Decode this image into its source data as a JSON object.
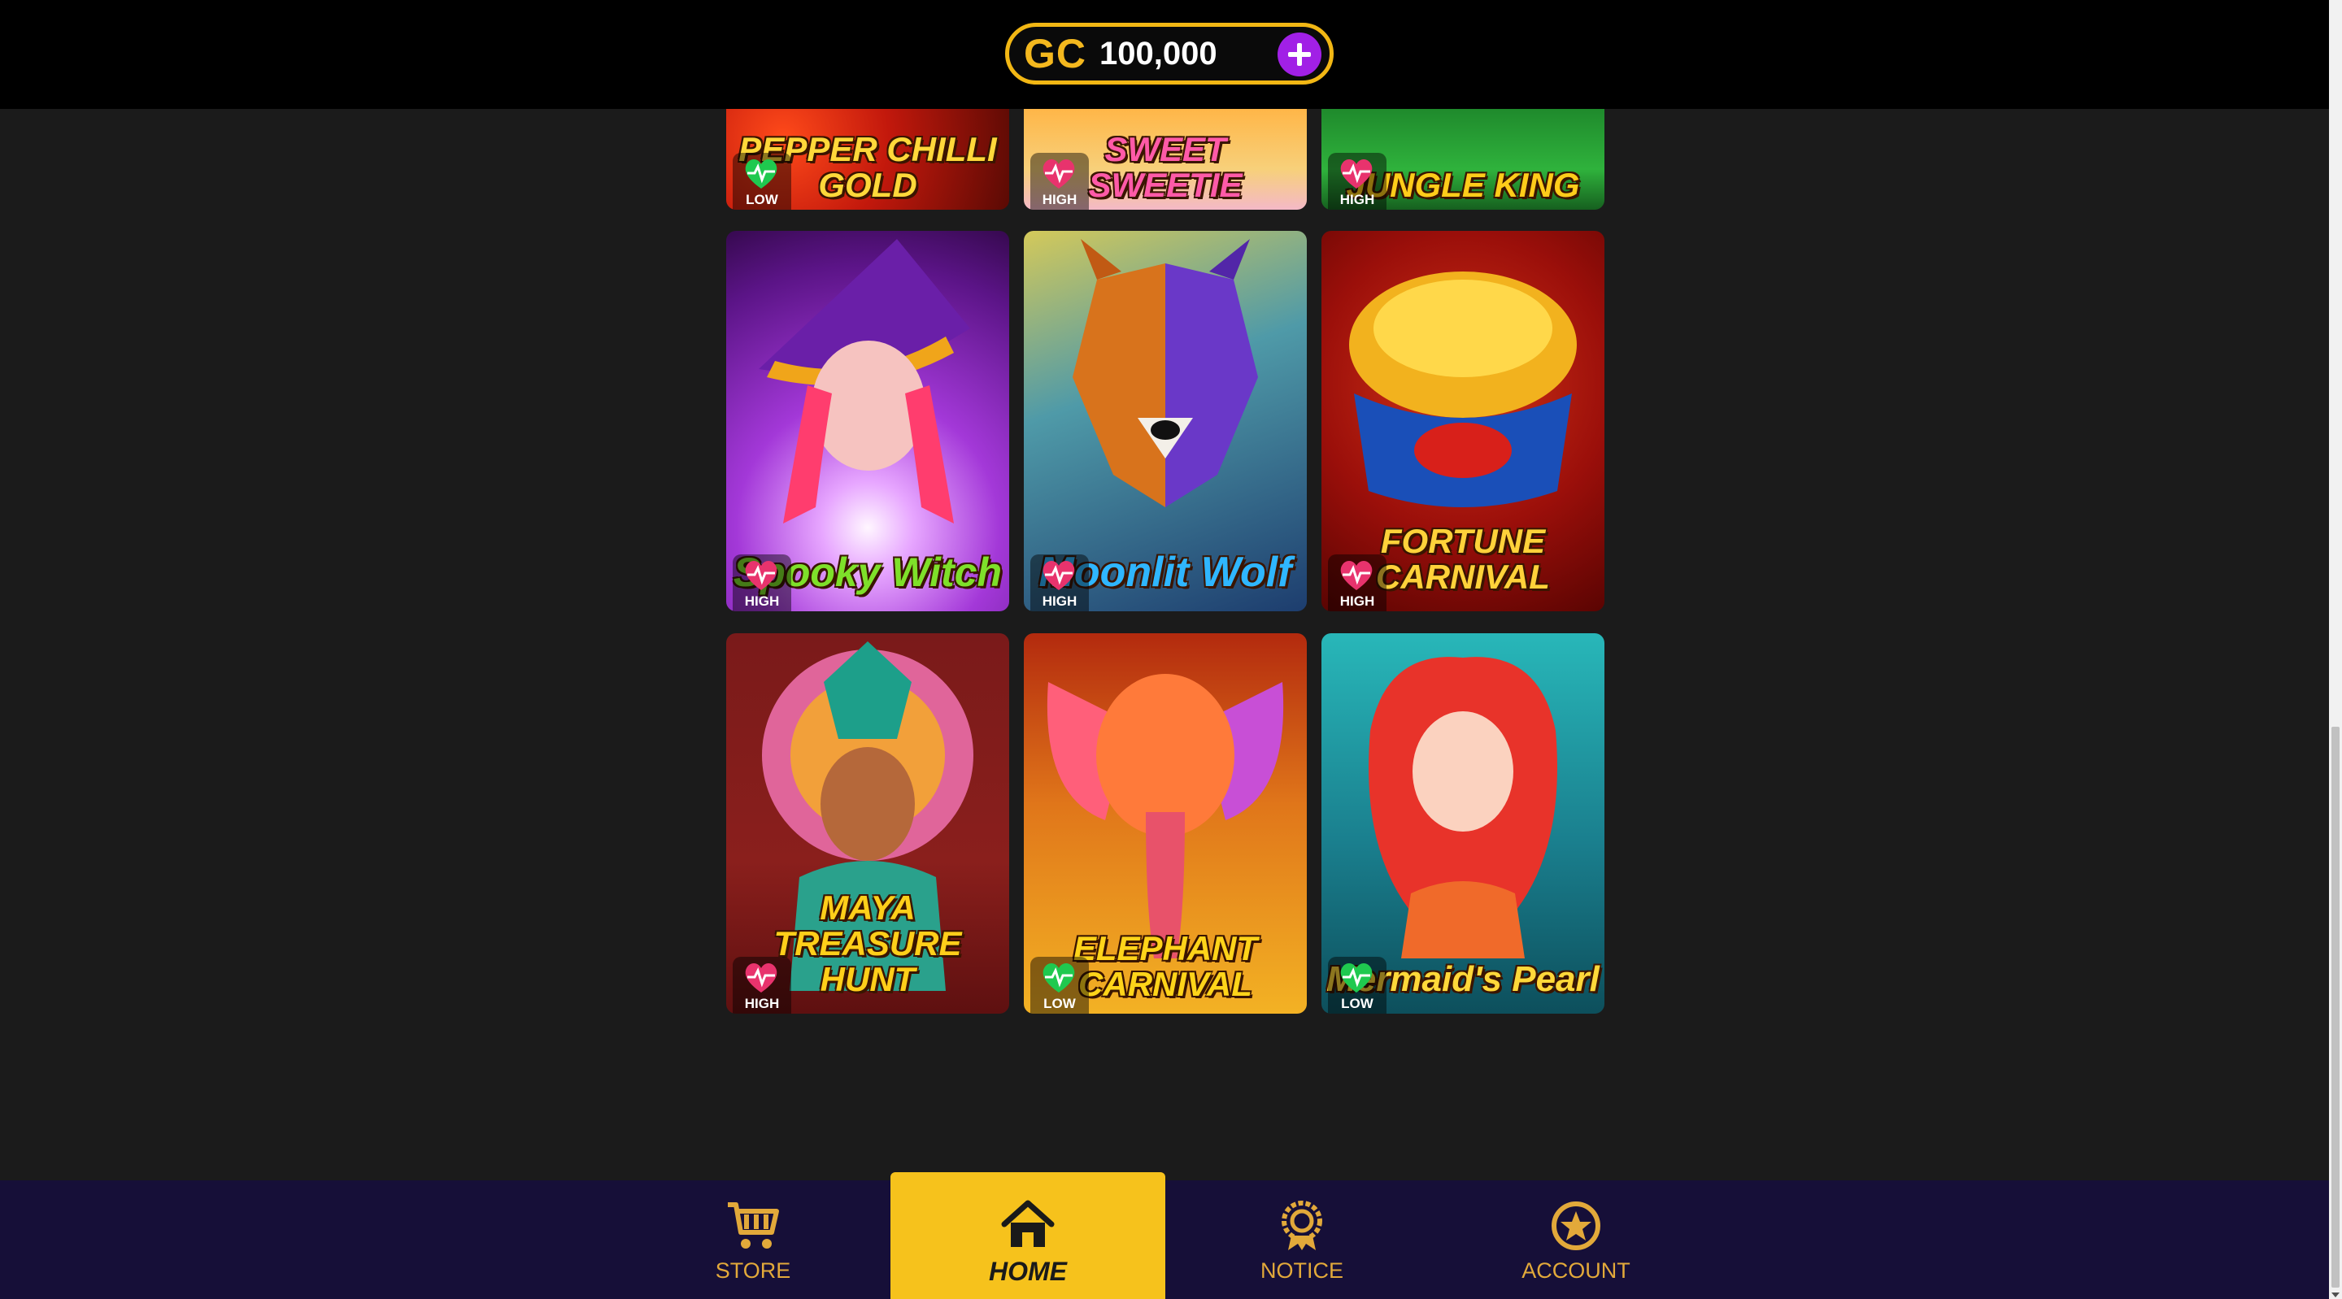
{
  "header": {
    "currency_label": "GC",
    "balance": "100,000",
    "add_icon": "plus-icon"
  },
  "games": [
    {
      "title": "PEPPER CHILLI GOLD",
      "volatility": "LOW",
      "partial": true
    },
    {
      "title": "SWEET SWEETIE",
      "volatility": "HIGH",
      "partial": true
    },
    {
      "title": "JUNGLE KING",
      "volatility": "HIGH",
      "partial": true
    },
    {
      "title": "Spooky Witch",
      "volatility": "HIGH"
    },
    {
      "title": "Moonlit Wolf",
      "volatility": "HIGH"
    },
    {
      "title": "FORTUNE CARNIVAL",
      "volatility": "HIGH"
    },
    {
      "title": "MAYA TREASURE HUNT",
      "volatility": "HIGH"
    },
    {
      "title": "ELEPHANT CARNIVAL",
      "volatility": "LOW"
    },
    {
      "title": "Mermaid's Pearl",
      "volatility": "LOW"
    }
  ],
  "volatility_colors": {
    "HIGH": "#e8336d",
    "LOW": "#1fc94f"
  },
  "nav": {
    "items": [
      {
        "label": "STORE",
        "icon": "cart-icon"
      },
      {
        "label": "HOME",
        "icon": "home-icon",
        "active": true
      },
      {
        "label": "NOTICE",
        "icon": "badge-icon"
      },
      {
        "label": "ACCOUNT",
        "icon": "star-icon"
      }
    ]
  }
}
